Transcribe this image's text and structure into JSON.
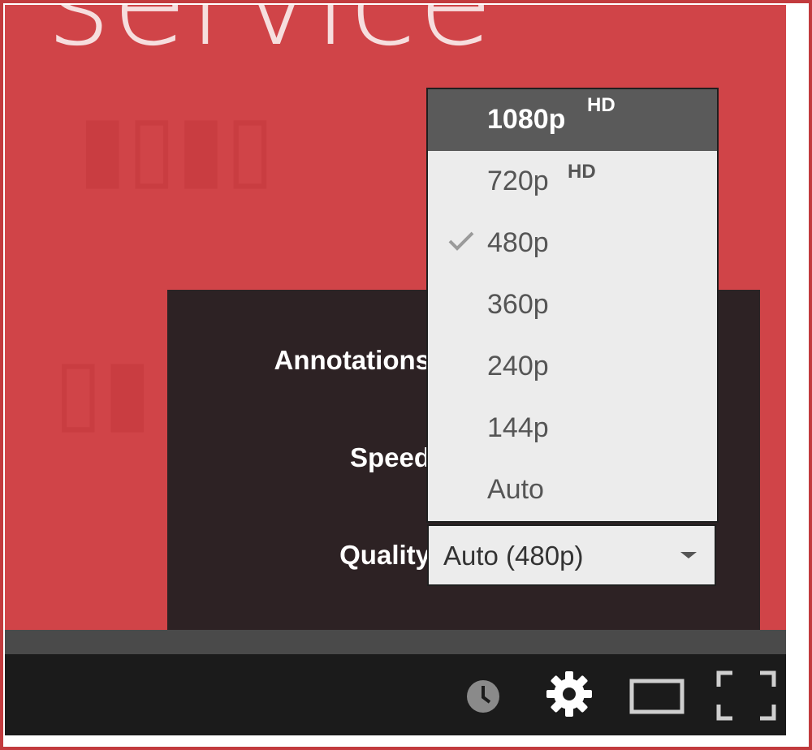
{
  "video": {
    "background_text": "service",
    "accent_color": "#d04448"
  },
  "settings": {
    "annotations_label": "Annotations",
    "speed_label": "Speed",
    "quality_label": "Quality",
    "quality_value": "Auto (480p)"
  },
  "quality_menu": {
    "options": [
      {
        "label": "1080p",
        "badge": "HD",
        "highlighted": true,
        "checked": false
      },
      {
        "label": "720p",
        "badge": "HD",
        "highlighted": false,
        "checked": false
      },
      {
        "label": "480p",
        "badge": "",
        "highlighted": false,
        "checked": true
      },
      {
        "label": "360p",
        "badge": "",
        "highlighted": false,
        "checked": false
      },
      {
        "label": "240p",
        "badge": "",
        "highlighted": false,
        "checked": false
      },
      {
        "label": "144p",
        "badge": "",
        "highlighted": false,
        "checked": false
      },
      {
        "label": "Auto",
        "badge": "",
        "highlighted": false,
        "checked": false
      }
    ]
  },
  "controls": {
    "icons": [
      "watch-later-icon",
      "settings-gear-icon",
      "theater-mode-icon",
      "fullscreen-icon"
    ]
  }
}
